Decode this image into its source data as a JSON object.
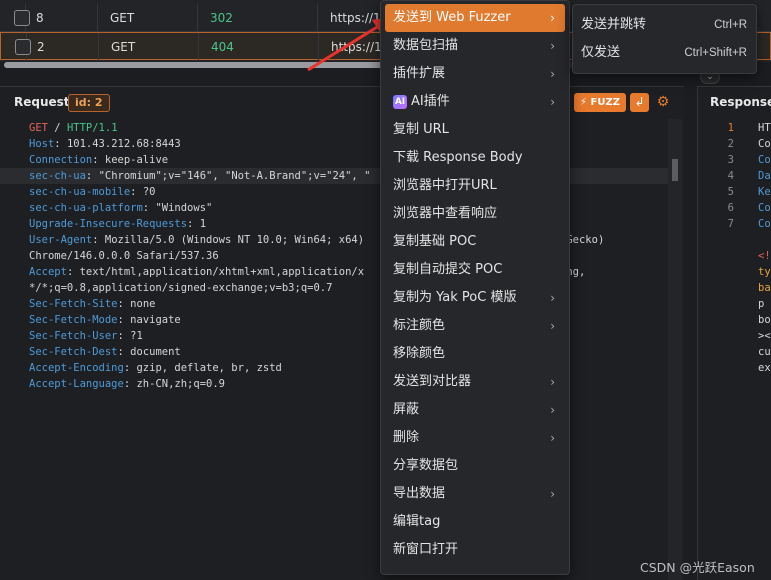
{
  "history": {
    "rows": [
      {
        "id": "8",
        "method": "GET",
        "status": "302",
        "url": "https://10"
      },
      {
        "id": "2",
        "method": "GET",
        "status": "404",
        "url": "https://10"
      }
    ]
  },
  "request": {
    "title": "Request",
    "id_badge": "id: 2",
    "fuzz_label": "FUZZ",
    "lines": [
      {
        "k": "GET",
        "sep": " / ",
        "v": "HTTP/1.1",
        "type": "reqline"
      },
      {
        "k": "Host",
        "sep": ": ",
        "v": "101.43.212.68:8443"
      },
      {
        "k": "Connection",
        "sep": ": ",
        "v": "keep-alive"
      },
      {
        "k": "sec-ch-ua",
        "sep": ": ",
        "v": "\"Chromium\";v=\"146\", \"Not-A.Brand\";v=\"24\", \"",
        "hl": true
      },
      {
        "k": "sec-ch-ua-mobile",
        "sep": ": ",
        "v": "?0"
      },
      {
        "k": "sec-ch-ua-platform",
        "sep": ": ",
        "v": "\"Windows\""
      },
      {
        "k": "Upgrade-Insecure-Requests",
        "sep": ": ",
        "v": "1"
      },
      {
        "k": "User-Agent",
        "sep": ": ",
        "v": "Mozilla/5.0 (Windows NT 10.0; Win64; x64)                            ike Gecko)"
      },
      {
        "k": "",
        "sep": "",
        "v": "Chrome/146.0.0.0 Safari/537.36"
      },
      {
        "k": "Accept",
        "sep": ": ",
        "v": "text/html,application/xhtml+xml,application/x                      p,image/apng,"
      },
      {
        "k": "",
        "sep": "",
        "v": "*/*;q=0.8,application/signed-exchange;v=b3;q=0.7"
      },
      {
        "k": "Sec-Fetch-Site",
        "sep": ": ",
        "v": "none"
      },
      {
        "k": "Sec-Fetch-Mode",
        "sep": ": ",
        "v": "navigate"
      },
      {
        "k": "Sec-Fetch-User",
        "sep": ": ",
        "v": "?1"
      },
      {
        "k": "Sec-Fetch-Dest",
        "sep": ": ",
        "v": "document"
      },
      {
        "k": "Accept-Encoding",
        "sep": ": ",
        "v": "gzip, deflate, br, zstd"
      },
      {
        "k": "Accept-Language",
        "sep": ": ",
        "v": "zh-CN,zh;q=0.9"
      }
    ]
  },
  "response": {
    "title": "Response",
    "lines": [
      {
        "n": "1",
        "t": "HT",
        "c": "c"
      },
      {
        "n": "2",
        "t": "Co",
        "c": "c"
      },
      {
        "n": "3",
        "t": "Co",
        "c": "b"
      },
      {
        "n": "4",
        "t": "Da",
        "c": "b"
      },
      {
        "n": "5",
        "t": "Ke",
        "c": "b"
      },
      {
        "n": "6",
        "t": "Co",
        "c": "b"
      },
      {
        "n": "7",
        "t": "Co",
        "c": "b"
      },
      {
        "n": "",
        "t": "",
        "c": "c"
      },
      {
        "n": "",
        "t": "<!",
        "c": "r"
      },
      {
        "n": "",
        "t": "ty",
        "c": "o"
      },
      {
        "n": "",
        "t": "ba",
        "c": "o"
      },
      {
        "n": "",
        "t": "p ",
        "c": "c"
      },
      {
        "n": "",
        "t": "bo",
        "c": "c"
      },
      {
        "n": "",
        "t": "><",
        "c": "c"
      },
      {
        "n": "",
        "t": "cu",
        "c": "c"
      },
      {
        "n": "",
        "t": "ex",
        "c": "c"
      }
    ]
  },
  "menu": {
    "items": [
      {
        "label": "发送到 Web Fuzzer",
        "arrow": true,
        "active": true
      },
      {
        "label": "数据包扫描",
        "arrow": true
      },
      {
        "label": "插件扩展",
        "arrow": true
      },
      {
        "label": "AI插件",
        "arrow": true,
        "ai": true
      },
      {
        "label": "复制 URL",
        "arrow": false
      },
      {
        "label": "下载 Response Body",
        "arrow": false
      },
      {
        "label": "浏览器中打开URL",
        "arrow": false
      },
      {
        "label": "浏览器中查看响应",
        "arrow": false
      },
      {
        "label": "复制基础 POC",
        "arrow": false
      },
      {
        "label": "复制自动提交 POC",
        "arrow": false
      },
      {
        "label": "复制为 Yak PoC 模版",
        "arrow": true
      },
      {
        "label": "标注颜色",
        "arrow": true
      },
      {
        "label": "移除颜色",
        "arrow": false
      },
      {
        "label": "发送到对比器",
        "arrow": true
      },
      {
        "label": "屏蔽",
        "arrow": true
      },
      {
        "label": "删除",
        "arrow": true
      },
      {
        "label": "分享数据包",
        "arrow": false
      },
      {
        "label": "导出数据",
        "arrow": true
      },
      {
        "label": "编辑tag",
        "arrow": false
      },
      {
        "label": "新窗口打开",
        "arrow": false
      }
    ],
    "ai_icon": "AI"
  },
  "submenu": {
    "items": [
      {
        "label": "发送并跳转",
        "shortcut": "Ctrl+R"
      },
      {
        "label": "仅发送",
        "shortcut": "Ctrl+Shift+R"
      }
    ]
  },
  "watermark": "CSDN @光跃Eason",
  "colors": {
    "accent": "#e07a2f",
    "success": "#4cc38a",
    "key": "#4f9ad8",
    "method": "#e0645a"
  }
}
